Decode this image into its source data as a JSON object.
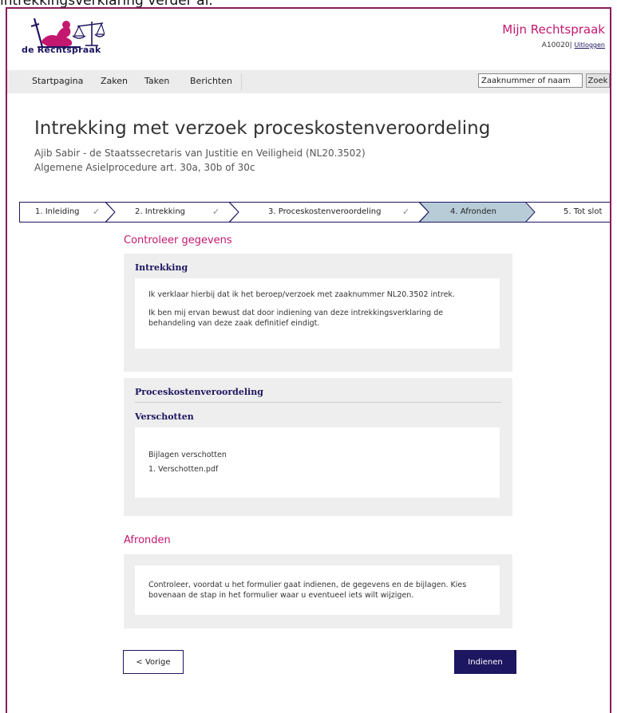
{
  "caption": "intrekkingsverklaring verder af.",
  "header": {
    "logo_text": "de Rechtspraak",
    "portal_title": "Mijn Rechtspraak",
    "user_id": "A10020",
    "user_sep": "|",
    "logout_label": "Uitloggen"
  },
  "nav": {
    "items": [
      {
        "label": "Startpagina"
      },
      {
        "label": "Zaken"
      },
      {
        "label": "Taken"
      },
      {
        "label": "Berichten"
      }
    ],
    "search_value": "Zaaknummer of naam",
    "search_button": "Zoek"
  },
  "page": {
    "title": "Intrekking met verzoek proceskostenveroordeling",
    "subtitle_line1": "Ajib Sabir - de Staatssecretaris van Justitie en Veiligheid (NL20.3502)",
    "subtitle_line2": "Algemene Asielprocedure art. 30a, 30b of 30c"
  },
  "steps": [
    {
      "label": "1. Inleiding",
      "done": true,
      "check": "✓",
      "active": false
    },
    {
      "label": "2. Intrekking",
      "done": true,
      "check": "✓",
      "active": false
    },
    {
      "label": "3. Proceskostenveroordeling",
      "done": true,
      "check": "✓",
      "active": false
    },
    {
      "label": "4. Afronden",
      "done": false,
      "check": "",
      "active": true
    },
    {
      "label": "5. Tot slot",
      "done": false,
      "check": "",
      "active": false
    }
  ],
  "check_section": {
    "heading": "Controleer gegevens",
    "intrekking": {
      "title": "Intrekking",
      "para1": "Ik verklaar hierbij dat ik het beroep/verzoek met zaaknummer NL20.3502 intrek.",
      "para2": "Ik ben mij ervan bewust dat door indiening van deze intrekkingsverklaring de behandeling van deze zaak definitief eindigt."
    },
    "proceskosten": {
      "title": "Proceskostenveroordeling",
      "subtitle": "Verschotten",
      "attachments_label": "Bijlagen verschotten",
      "attachment_1": "1. Verschotten.pdf"
    }
  },
  "finish_section": {
    "heading": "Afronden",
    "text": "Controleer, voordat u het formulier gaat indienen, de gegevens en de bijlagen. Kies bovenaan de stap in het formulier waar u eventueel iets wilt wijzigen."
  },
  "buttons": {
    "prev": "< Vorige",
    "submit": "Indienen"
  },
  "colors": {
    "brand_magenta": "#c4176f",
    "brand_navy": "#1d1660",
    "frame": "#8b1a5c",
    "step_active": "#b8ccd8"
  }
}
